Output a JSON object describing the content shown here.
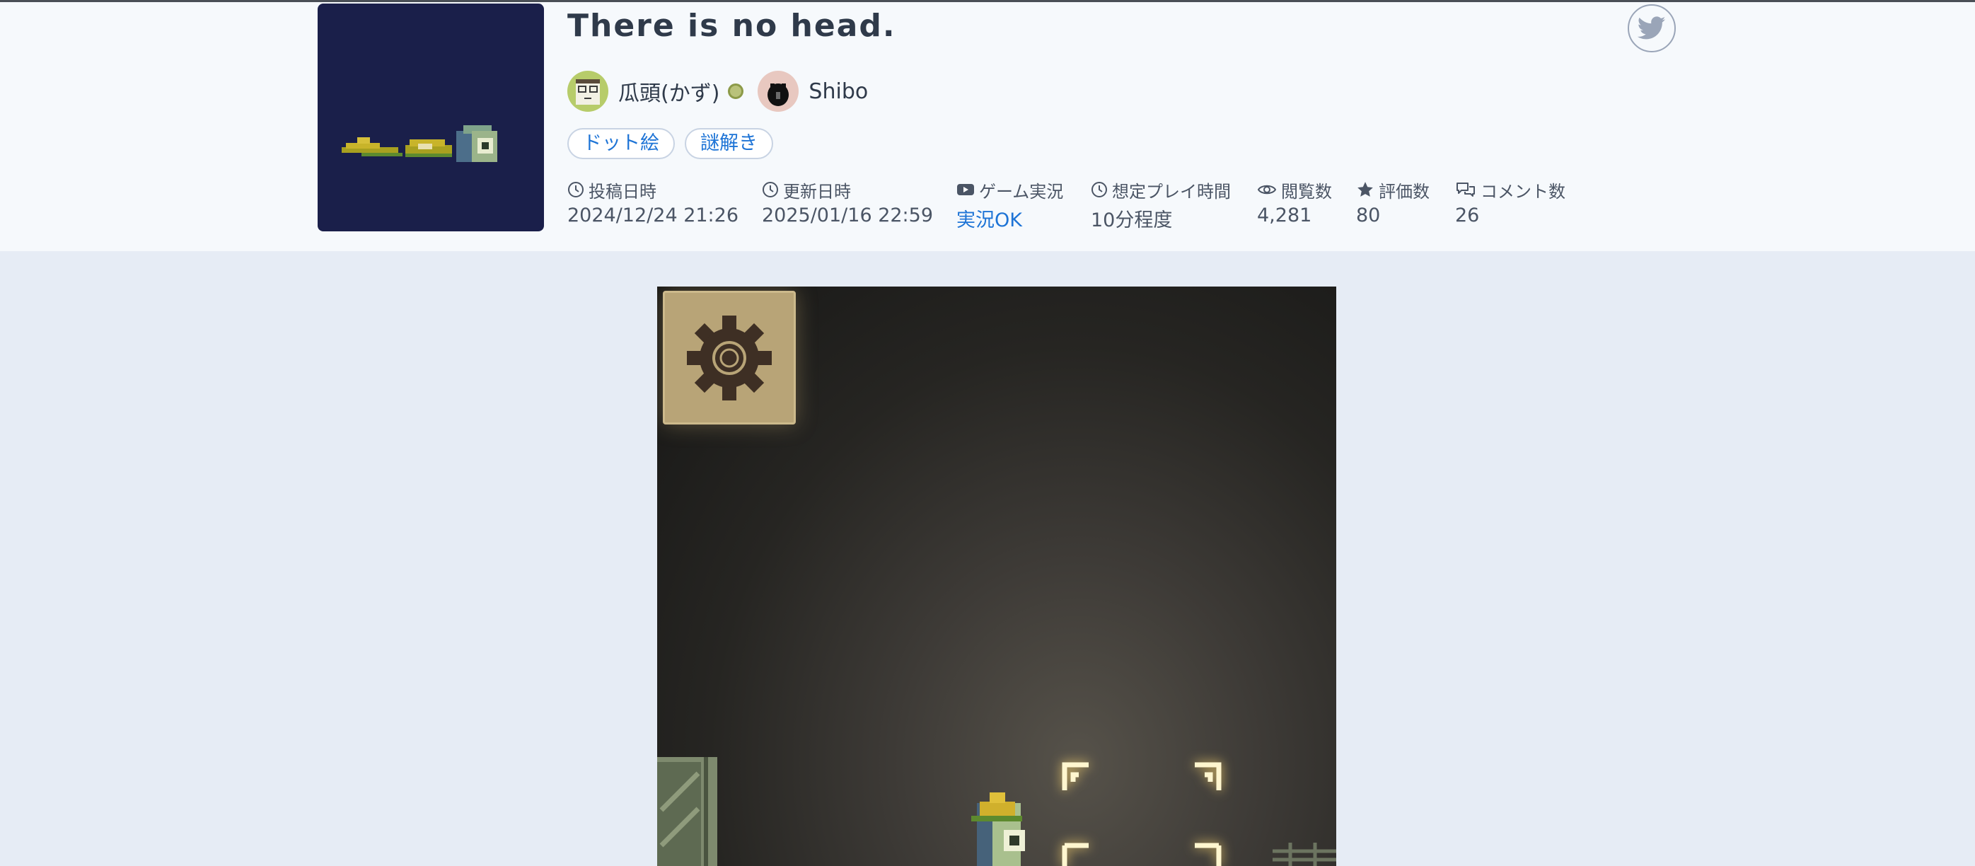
{
  "game": {
    "title": "There is no head."
  },
  "authors": [
    {
      "name": "瓜頭(かず)",
      "avatar_icon": "melon-face-avatar-icon"
    },
    {
      "name": "Shibo",
      "avatar_icon": "black-creature-avatar-icon"
    }
  ],
  "tags": [
    "ドット絵",
    "謎解き"
  ],
  "meta": {
    "posted": {
      "label": "投稿日時",
      "value": "2024/12/24 21:26",
      "icon": "clock-icon"
    },
    "updated": {
      "label": "更新日時",
      "value": "2025/01/16 22:59",
      "icon": "clock-icon"
    },
    "streaming": {
      "label": "ゲーム実況",
      "value": "実況OK",
      "icon": "youtube-icon"
    },
    "playtime": {
      "label": "想定プレイ時間",
      "value": "10分程度",
      "icon": "clock-icon"
    },
    "views": {
      "label": "閲覧数",
      "value": "4,281",
      "icon": "eye-icon"
    },
    "ratings": {
      "label": "評価数",
      "value": "80",
      "icon": "star-icon"
    },
    "comments": {
      "label": "コメント数",
      "value": "26",
      "icon": "chat-bubbles-icon"
    }
  },
  "colors": {
    "accent": "#1e74d6",
    "thumbnail_bg": "#1a1f4a",
    "page_bg": "#e6ecf5",
    "header_bg": "#f6f9fc"
  }
}
